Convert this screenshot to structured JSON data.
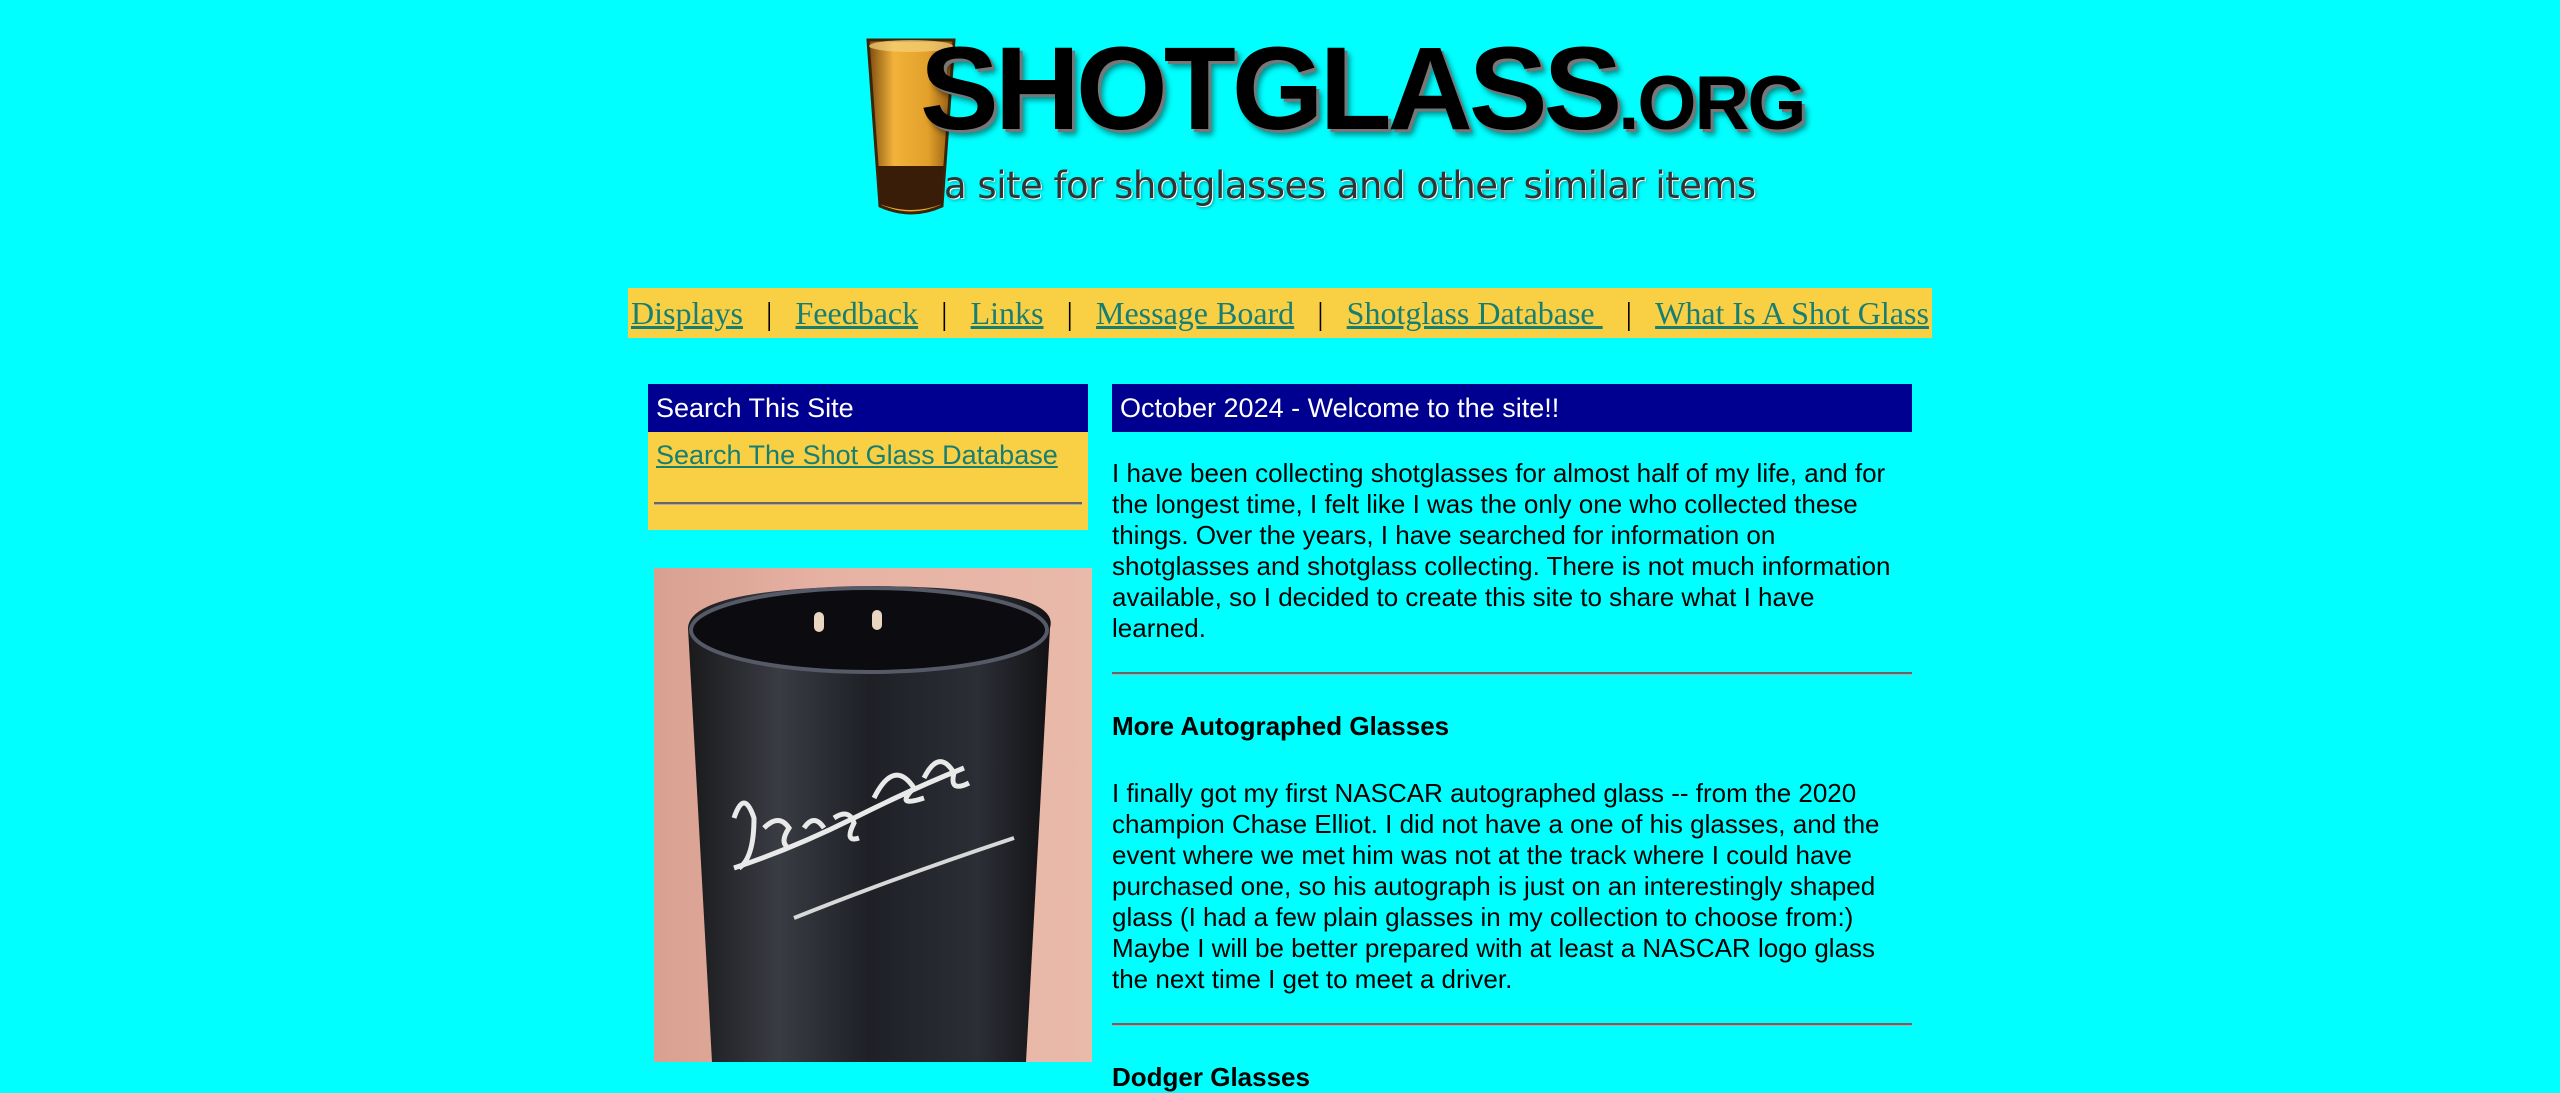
{
  "logo": {
    "title_main": "SHOTGLASS",
    "title_suffix": ".ORG",
    "tagline": "a site for shotglasses and other similar items"
  },
  "nav": {
    "separator": "|",
    "items": [
      {
        "label": "Displays"
      },
      {
        "label": "Feedback"
      },
      {
        "label": "Links"
      },
      {
        "label": "Message Board"
      },
      {
        "label": "Shotglass Database "
      },
      {
        "label": "What Is A Shot Glass"
      }
    ]
  },
  "sidebar": {
    "title": "Search This Site",
    "search_link": "Search The Shot Glass Database",
    "photo_signature": "George Drake"
  },
  "main": {
    "title": "October 2024 - Welcome to the site!!",
    "intro": "I have been collecting shotglasses for almost half of my life, and for the longest time, I felt like I was the only one who collected these things. Over the years, I have searched for information on shotglasses and shotglass collecting. There is not much information available, so I decided to create this site to share what I have learned.",
    "sections": [
      {
        "heading": "More Autographed Glasses",
        "body": "I finally got my first NASCAR autographed glass -- from the 2020 champion Chase Elliot. I did not have a one of his glasses, and the event where we met him was not at the track where I could have purchased one, so his autograph is just on an interestingly shaped glass (I had a few plain glasses in my collection to choose from:) Maybe I will be better prepared with at least a NASCAR logo glass the next time I get to meet a driver."
      },
      {
        "heading": "Dodger Glasses",
        "body": ""
      }
    ]
  },
  "colors": {
    "background": "#00ffff",
    "accent_yellow": "#f9d043",
    "header_navy": "#000090",
    "link_teal": "#177e74"
  }
}
